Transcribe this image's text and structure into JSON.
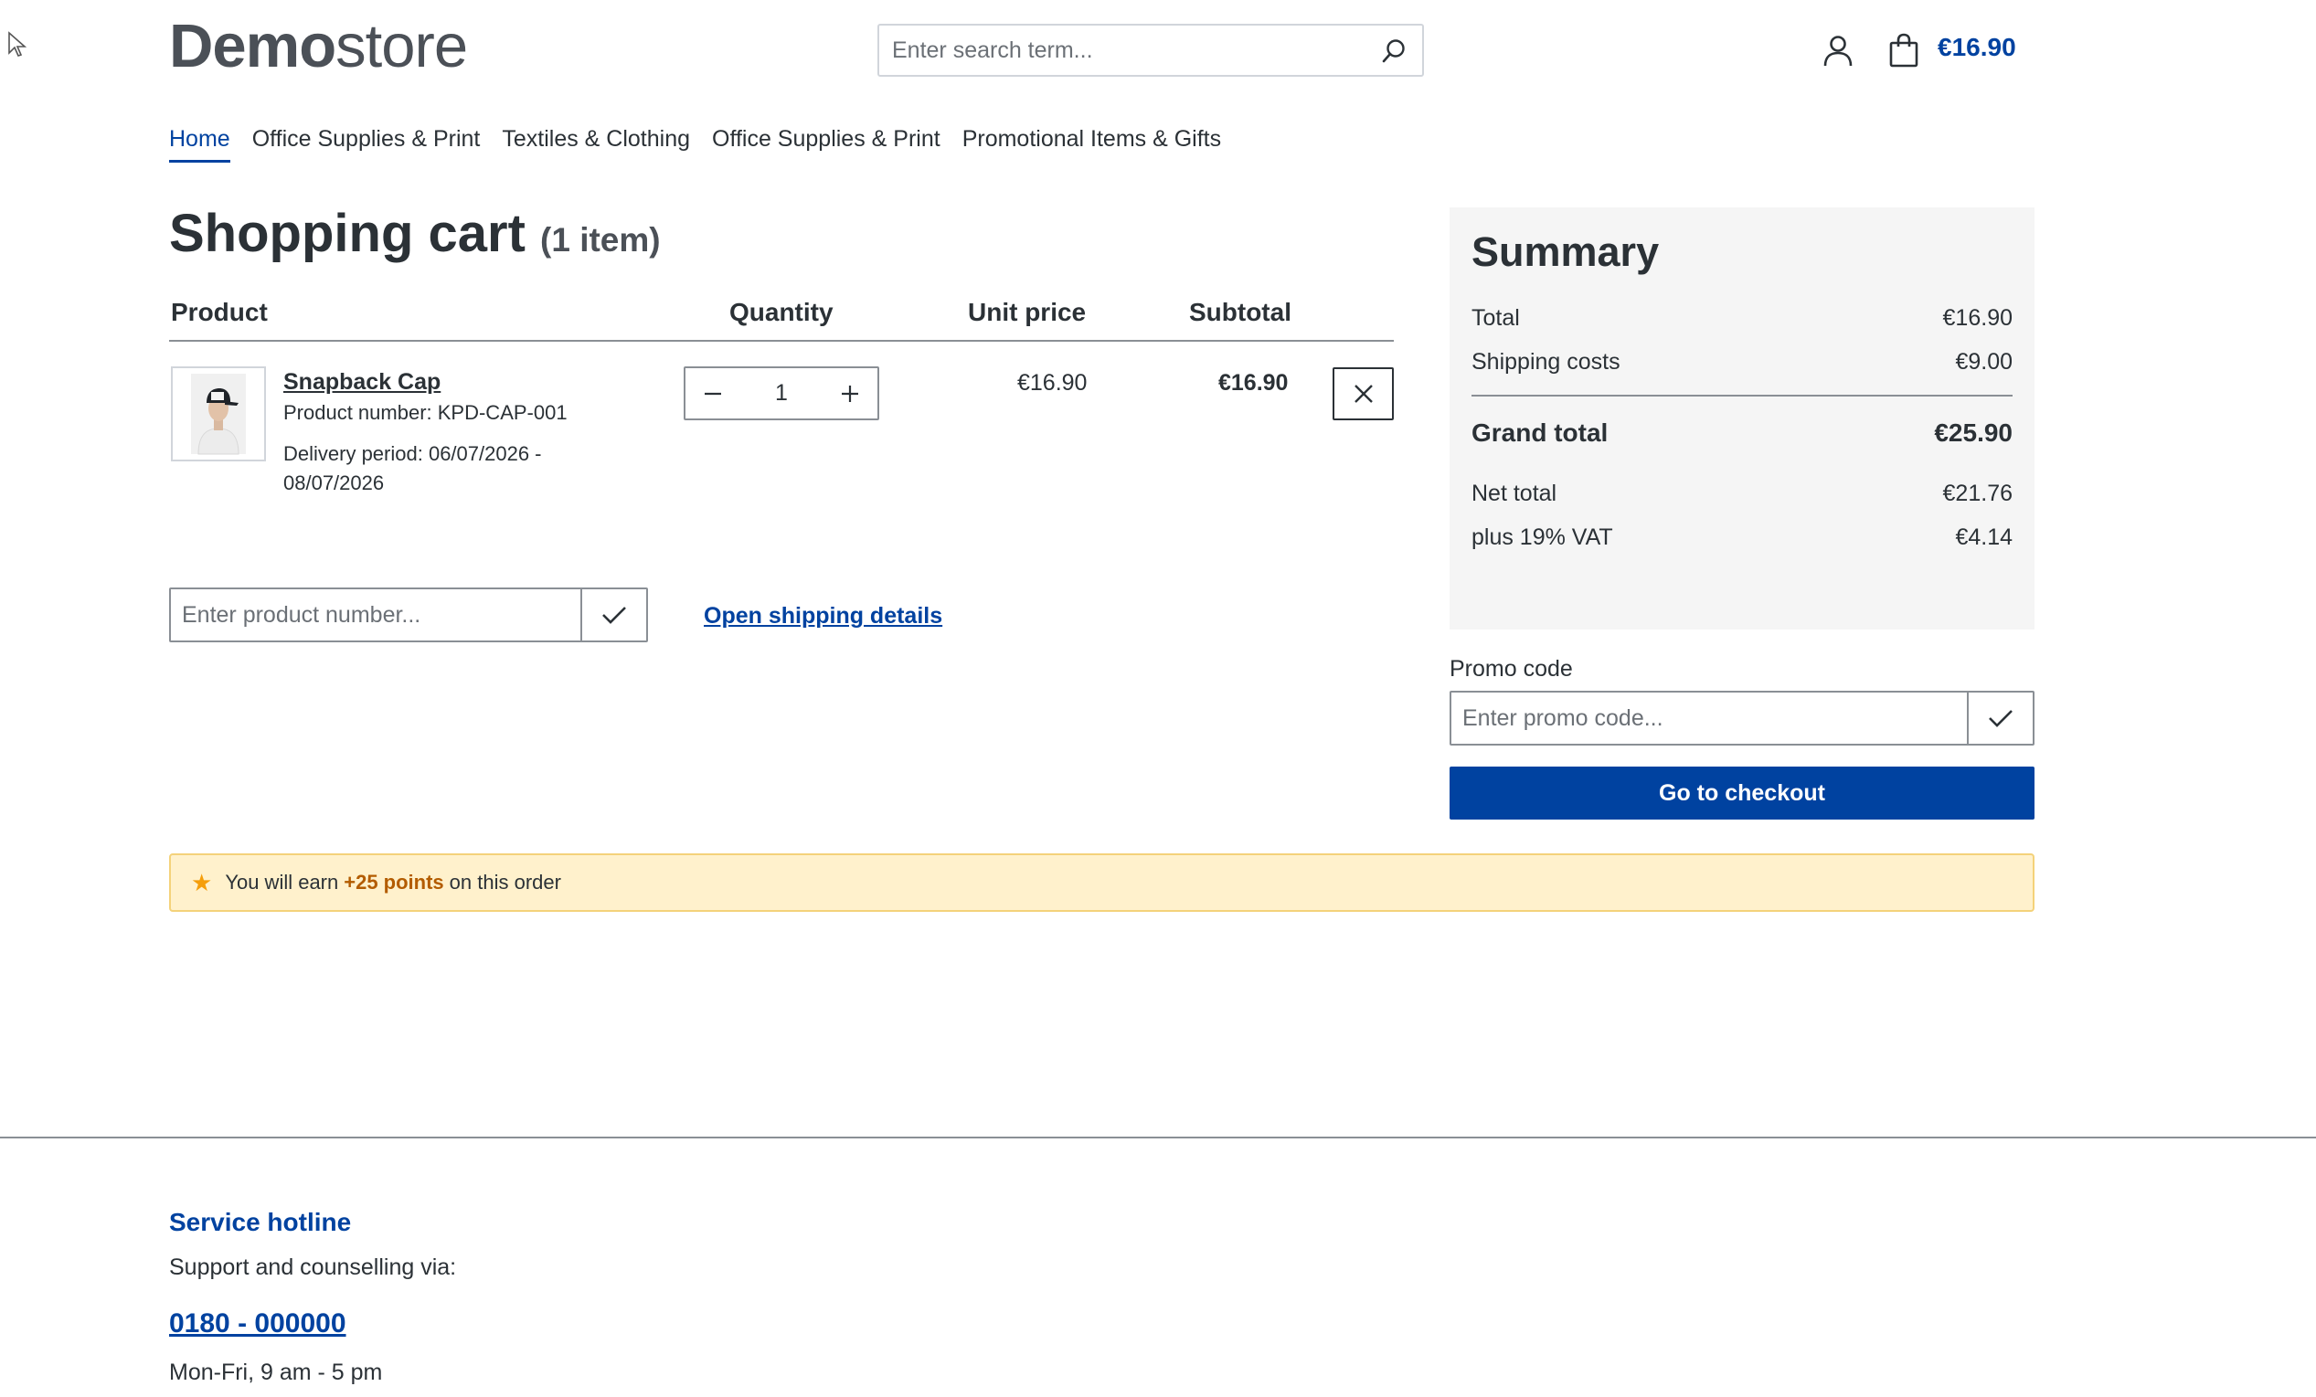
{
  "header": {
    "logo_bold": "Demo",
    "logo_light": "store",
    "search_placeholder": "Enter search term...",
    "cart_total": "€16.90"
  },
  "nav": {
    "items": [
      {
        "label": "Home",
        "active": true
      },
      {
        "label": "Office Supplies & Print",
        "active": false
      },
      {
        "label": "Textiles & Clothing",
        "active": false
      },
      {
        "label": "Office Supplies & Print",
        "active": false
      },
      {
        "label": "Promotional Items & Gifts",
        "active": false
      }
    ]
  },
  "cart": {
    "title": "Shopping cart",
    "count": "(1 item)",
    "columns": {
      "product": "Product",
      "quantity": "Quantity",
      "unit_price": "Unit price",
      "subtotal": "Subtotal"
    },
    "items": [
      {
        "name": "Snapback Cap",
        "product_number": "Product number: KPD-CAP-001",
        "delivery": "Delivery period: 06/07/2026 - 08/07/2026",
        "quantity": "1",
        "unit_price": "€16.90",
        "subtotal": "€16.90"
      }
    ],
    "product_number_placeholder": "Enter product number...",
    "shipping_link": "Open shipping details"
  },
  "summary": {
    "title": "Summary",
    "total_label": "Total",
    "total_value": "€16.90",
    "shipping_label": "Shipping costs",
    "shipping_value": "€9.00",
    "grand_label": "Grand total",
    "grand_value": "€25.90",
    "net_label": "Net total",
    "net_value": "€21.76",
    "vat_label": "plus 19% VAT",
    "vat_value": "€4.14"
  },
  "promo": {
    "label": "Promo code",
    "placeholder": "Enter promo code...",
    "checkout_label": "Go to checkout"
  },
  "points": {
    "prefix": "You will earn",
    "amount": "+25 points",
    "suffix": "on this order"
  },
  "footer": {
    "hotline_title": "Service hotline",
    "hotline_sub": "Support and counselling via:",
    "phone": "0180 - 000000",
    "hours": "Mon-Fri, 9 am - 5 pm"
  },
  "colors": {
    "brand": "#0042a0",
    "banner_bg": "#fff1cc",
    "points_accent": "#b35c00"
  },
  "icons": [
    "search-icon",
    "account-icon",
    "cart-icon",
    "minus-icon",
    "plus-icon",
    "close-icon",
    "checkmark-icon",
    "star-icon",
    "cursor-icon"
  ]
}
